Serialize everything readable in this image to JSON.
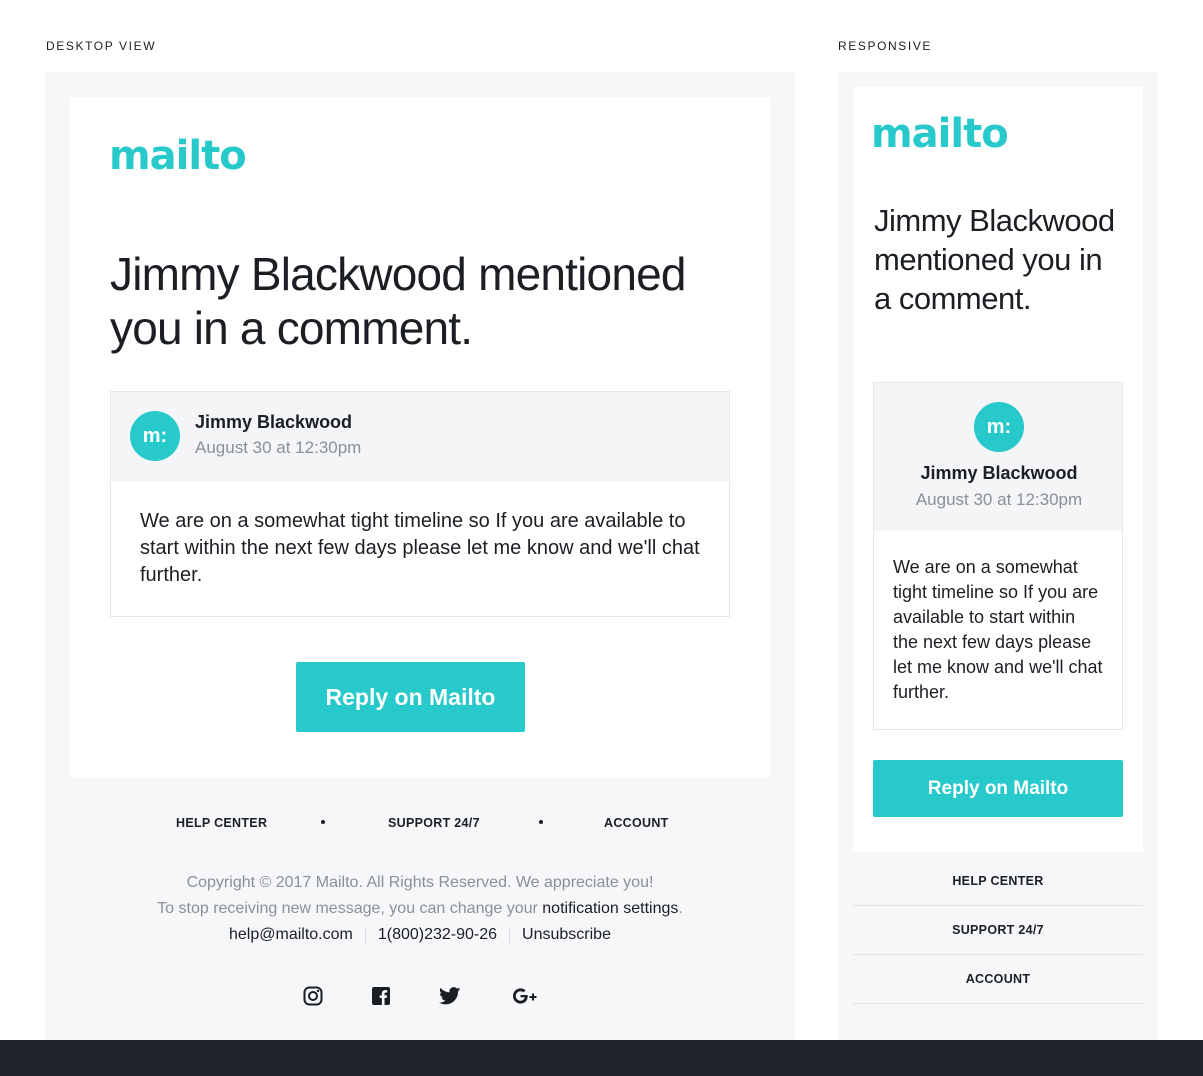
{
  "labels": {
    "desktop": "DESKTOP VIEW",
    "responsive": "RESPONSIVE"
  },
  "brand": {
    "name": "mailto",
    "accent": "#27c9cb"
  },
  "email": {
    "headline": "Jimmy Blackwood mentioned you in a comment.",
    "comment": {
      "avatar_text": "m:",
      "author": "Jimmy Blackwood",
      "date": "August 30 at 12:30pm",
      "body": "We are on a somewhat tight timeline so If you are available to start within the next few days please let me know and we'll chat further."
    },
    "reply_label": "Reply on Mailto"
  },
  "footer": {
    "nav": [
      "HELP CENTER",
      "SUPPORT 24/7",
      "ACCOUNT"
    ],
    "copyright": "Copyright © 2017 Mailto. All Rights Reserved. We appreciate you!",
    "stop_text": "To stop receiving new message, you can change your ",
    "notification_link": "notification settings",
    "stop_end": ".",
    "email": "help@mailto.com",
    "phone": "1(800)232-90-26",
    "unsubscribe": "Unsubscribe",
    "social_icons": [
      "instagram-icon",
      "facebook-icon",
      "twitter-icon",
      "google-plus-icon"
    ]
  }
}
